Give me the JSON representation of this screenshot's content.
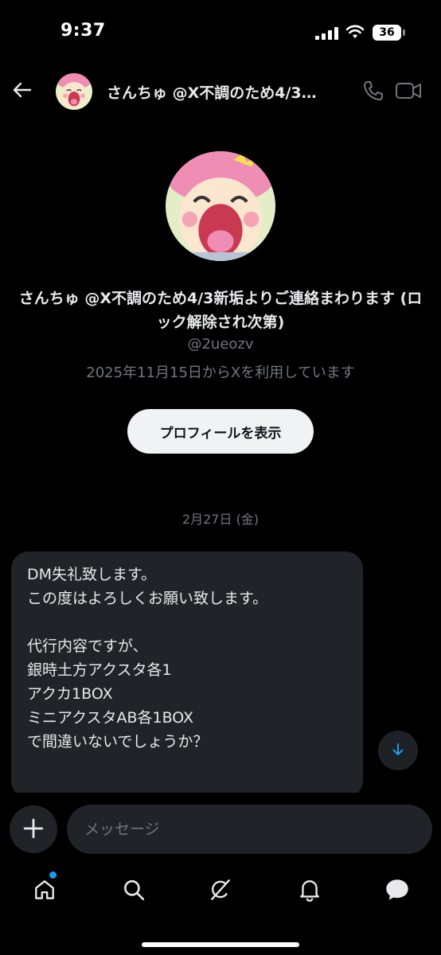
{
  "status_bar": {
    "time": "9:37",
    "battery": "36"
  },
  "header": {
    "title": "さんちゅ @X不調のため4/3…"
  },
  "profile": {
    "name": "さんちゅ @X不調のため4/3新垢よりご連絡まわります (ロック解除され次第)",
    "handle": "@2ueozv",
    "joined": "2025年11月15日からXを利用しています",
    "view_profile_label": "プロフィールを表示"
  },
  "conversation": {
    "date_separator": "2月27日 (金)",
    "messages": [
      {
        "text": "DM失礼致します。\nこの度はよろしくお願い致します。\n\n代行内容ですが、\n銀時土方アクスタ各1\nアクカ1BOX\nミニアクスタAB各1BOX\nで間違いないでしょうか？"
      }
    ]
  },
  "compose": {
    "placeholder": "メッセージ"
  },
  "tabbar": {
    "items": [
      {
        "icon": "home-icon"
      },
      {
        "icon": "search-icon"
      },
      {
        "icon": "grok-icon"
      },
      {
        "icon": "bell-icon"
      },
      {
        "icon": "messages-icon"
      }
    ]
  },
  "colors": {
    "accent": "#1d9bf0",
    "background": "#000000",
    "bubble": "#202327"
  }
}
